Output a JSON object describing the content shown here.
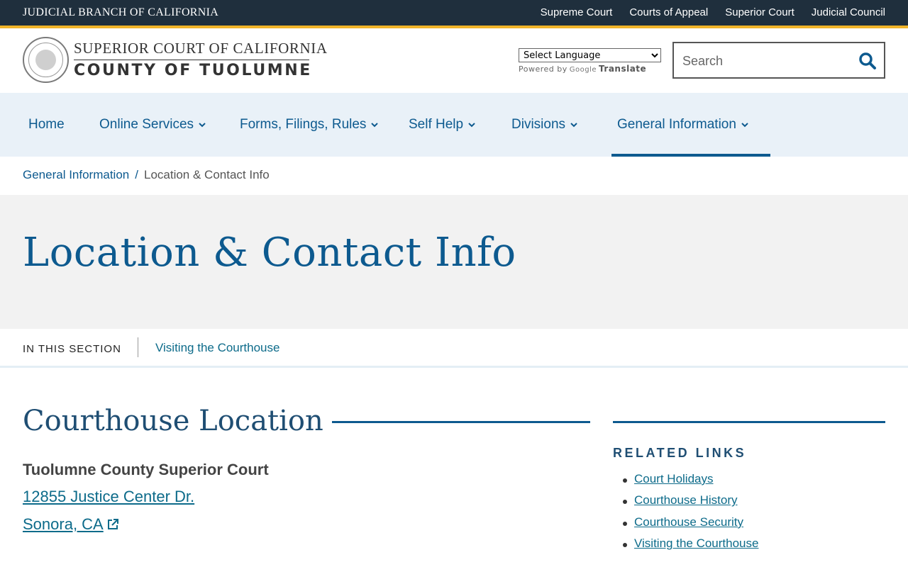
{
  "topbar": {
    "title": "JUDICIAL BRANCH OF CALIFORNIA",
    "links": [
      "Supreme Court",
      "Courts of Appeal",
      "Superior Court",
      "Judicial Council"
    ]
  },
  "header": {
    "logo_line1": "SUPERIOR COURT OF CALIFORNIA",
    "logo_line2": "COUNTY OF TUOLUMNE",
    "language_select": "Select Language",
    "powered_by": "Powered by",
    "google": "Google",
    "translate": "Translate",
    "search_placeholder": "Search"
  },
  "nav": {
    "items": [
      {
        "label": "Home",
        "has_dropdown": false
      },
      {
        "label": "Online Services",
        "has_dropdown": true
      },
      {
        "label": "Forms, Filings, Rules",
        "has_dropdown": true
      },
      {
        "label": "Self Help",
        "has_dropdown": true
      },
      {
        "label": "Divisions",
        "has_dropdown": true
      },
      {
        "label": "General Information",
        "has_dropdown": true,
        "active": true
      }
    ]
  },
  "breadcrumb": {
    "parent": "General Information",
    "separator": "/",
    "current": "Location & Contact Info"
  },
  "page": {
    "title": "Location & Contact Info"
  },
  "section_nav": {
    "label": "IN THIS SECTION",
    "links": [
      "Visiting the Courthouse"
    ]
  },
  "content": {
    "heading": "Courthouse Location",
    "court_name": "Tuolumne County Superior Court",
    "address_line1": "12855 Justice Center Dr.",
    "address_line2": "Sonora, CA"
  },
  "sidebar": {
    "title": "RELATED LINKS",
    "links": [
      "Court Holidays",
      "Courthouse History",
      "Courthouse Security",
      "Visiting the Courthouse"
    ]
  },
  "colors": {
    "topbar": "#1f2f3d",
    "stripe": "#f0b429",
    "primary": "#0d5a8f",
    "nav_bg": "#e9f1f8",
    "hero_bg": "#f2f2f2"
  }
}
